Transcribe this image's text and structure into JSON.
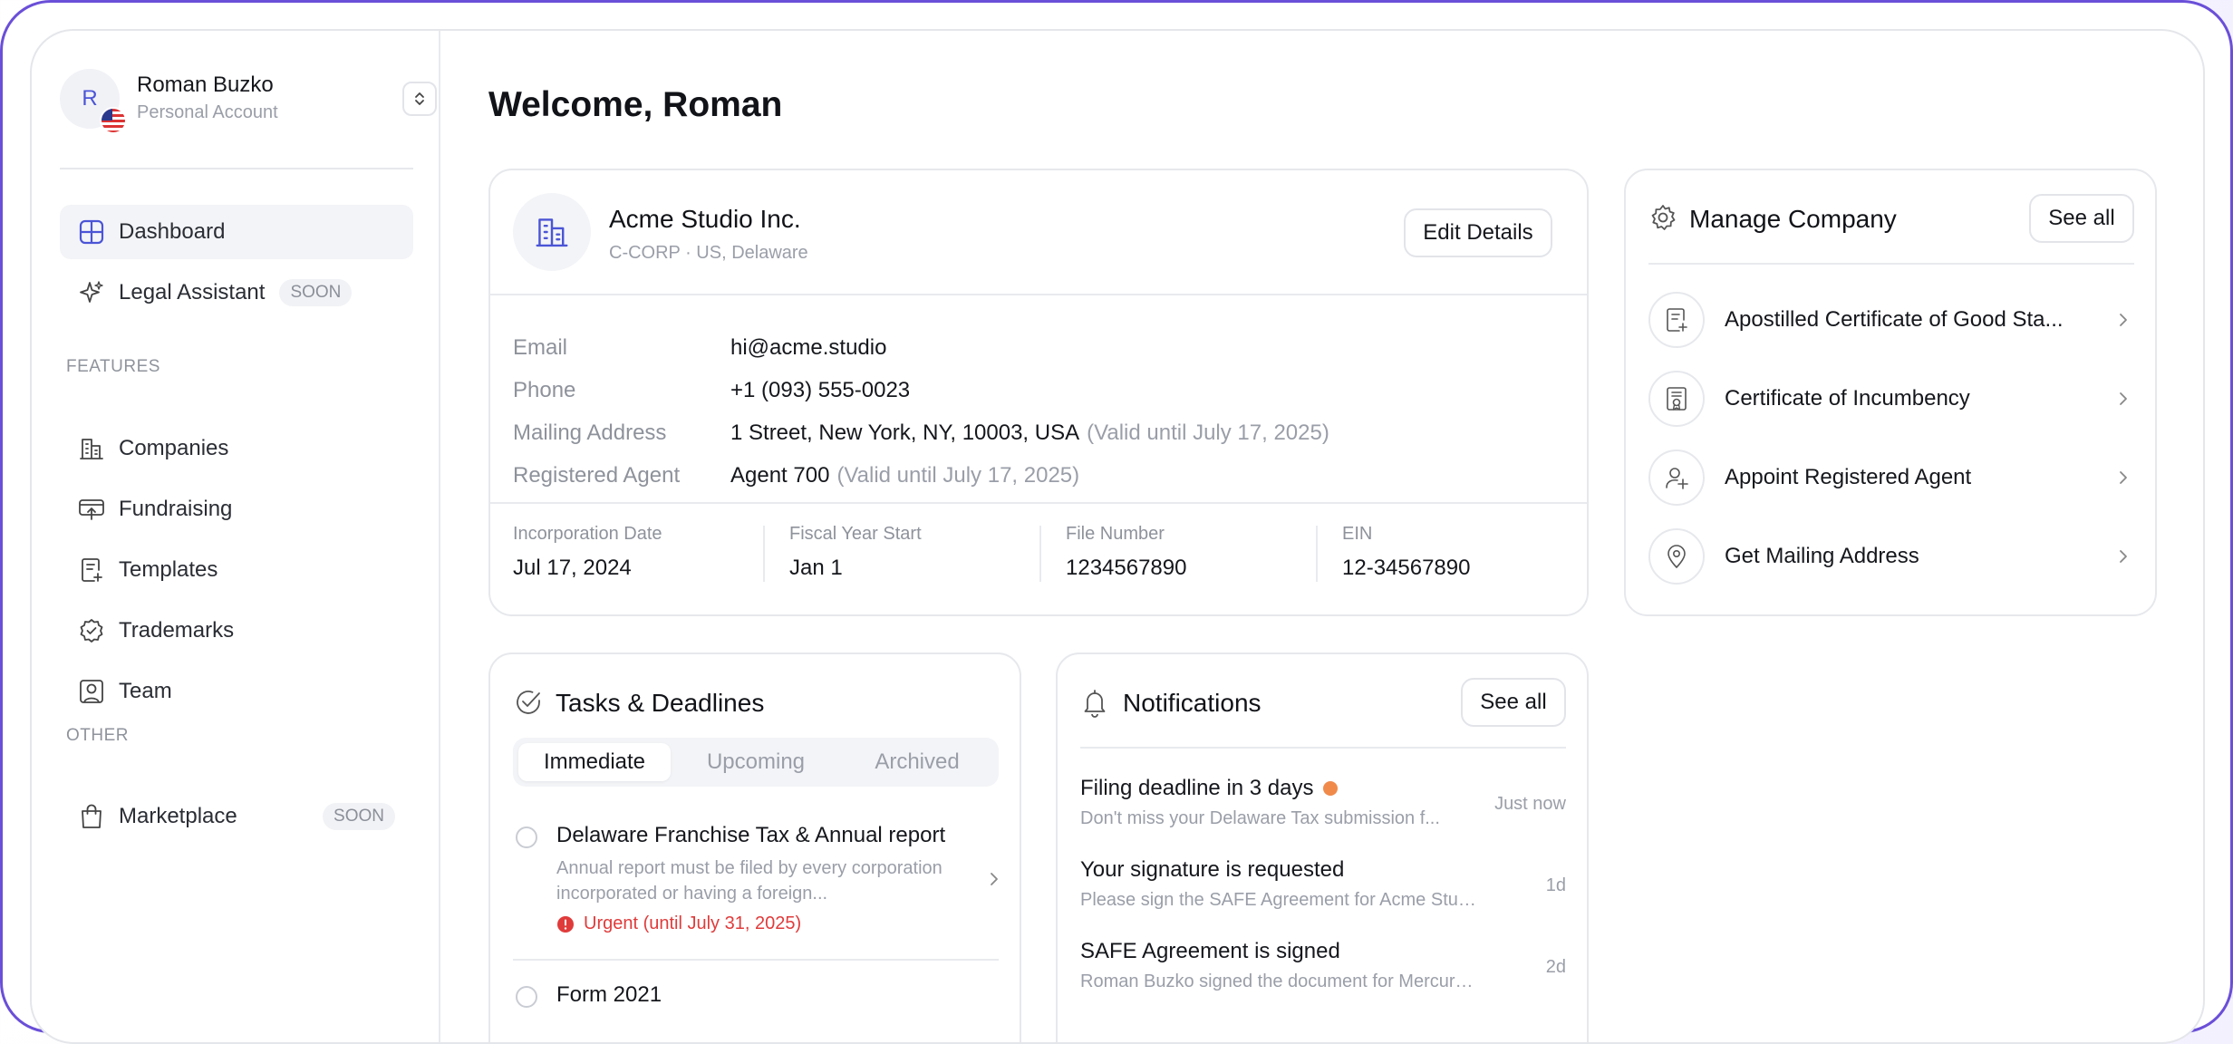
{
  "account": {
    "initial": "R",
    "name": "Roman Buzko",
    "type": "Personal Account"
  },
  "sidebar": {
    "items": [
      {
        "label": "Dashboard"
      },
      {
        "label": "Legal Assistant",
        "badge": "SOON"
      }
    ],
    "features_heading": "FEATURES",
    "features": [
      {
        "label": "Companies"
      },
      {
        "label": "Fundraising"
      },
      {
        "label": "Templates"
      },
      {
        "label": "Trademarks"
      },
      {
        "label": "Team"
      }
    ],
    "other_heading": "OTHER",
    "other": [
      {
        "label": "Marketplace",
        "badge": "SOON"
      }
    ]
  },
  "main": {
    "welcome": "Welcome, Roman"
  },
  "company": {
    "name": "Acme Studio Inc.",
    "subtitle": "C-CORP · US, Delaware",
    "edit_label": "Edit Details",
    "details": [
      {
        "key": "Email",
        "value": "hi@acme.studio",
        "note": ""
      },
      {
        "key": "Phone",
        "value": "+1 (093) 555-0023",
        "note": ""
      },
      {
        "key": "Mailing Address",
        "value": "1 Street, New York, NY, 10003, USA",
        "note": "(Valid until July 17, 2025)"
      },
      {
        "key": "Registered Agent",
        "value": "Agent 700",
        "note": "(Valid until July 17, 2025)"
      }
    ],
    "stats": [
      {
        "key": "Incorporation Date",
        "value": "Jul 17, 2024"
      },
      {
        "key": "Fiscal Year Start",
        "value": "Jan 1"
      },
      {
        "key": "File Number",
        "value": "1234567890"
      },
      {
        "key": "EIN",
        "value": "12-34567890"
      }
    ]
  },
  "manage": {
    "title": "Manage Company",
    "see_all": "See all",
    "items": [
      {
        "label": "Apostilled Certificate of Good Sta..."
      },
      {
        "label": "Certificate of Incumbency"
      },
      {
        "label": "Appoint Registered Agent"
      },
      {
        "label": "Get Mailing Address"
      }
    ]
  },
  "tasks": {
    "title": "Tasks & Deadlines",
    "tabs": [
      "Immediate",
      "Upcoming",
      "Archived"
    ],
    "items": [
      {
        "title": "Delaware Franchise Tax & Annual report",
        "desc": "Annual report must be filed by every corporation incorporated or having a foreign...",
        "urgent": "Urgent (until July 31, 2025)"
      },
      {
        "title": "Form 2021"
      }
    ]
  },
  "notifications": {
    "title": "Notifications",
    "see_all": "See all",
    "items": [
      {
        "title": "Filing deadline in 3 days",
        "desc": "Don't miss your Delaware Tax submission f...",
        "time": "Just now"
      },
      {
        "title": "Your signature is requested",
        "desc": "Please sign the SAFE Agreement for Acme Studio.",
        "time": "1d"
      },
      {
        "title": "SAFE Agreement is signed",
        "desc": "Roman Buzko signed the document for Mercury I...",
        "time": "2d"
      }
    ]
  },
  "colors": {
    "accent": "#4b55d6",
    "frame": "#6a4fd8",
    "urgent": "#e03b3b",
    "notification_dot": "#f08a4b"
  }
}
